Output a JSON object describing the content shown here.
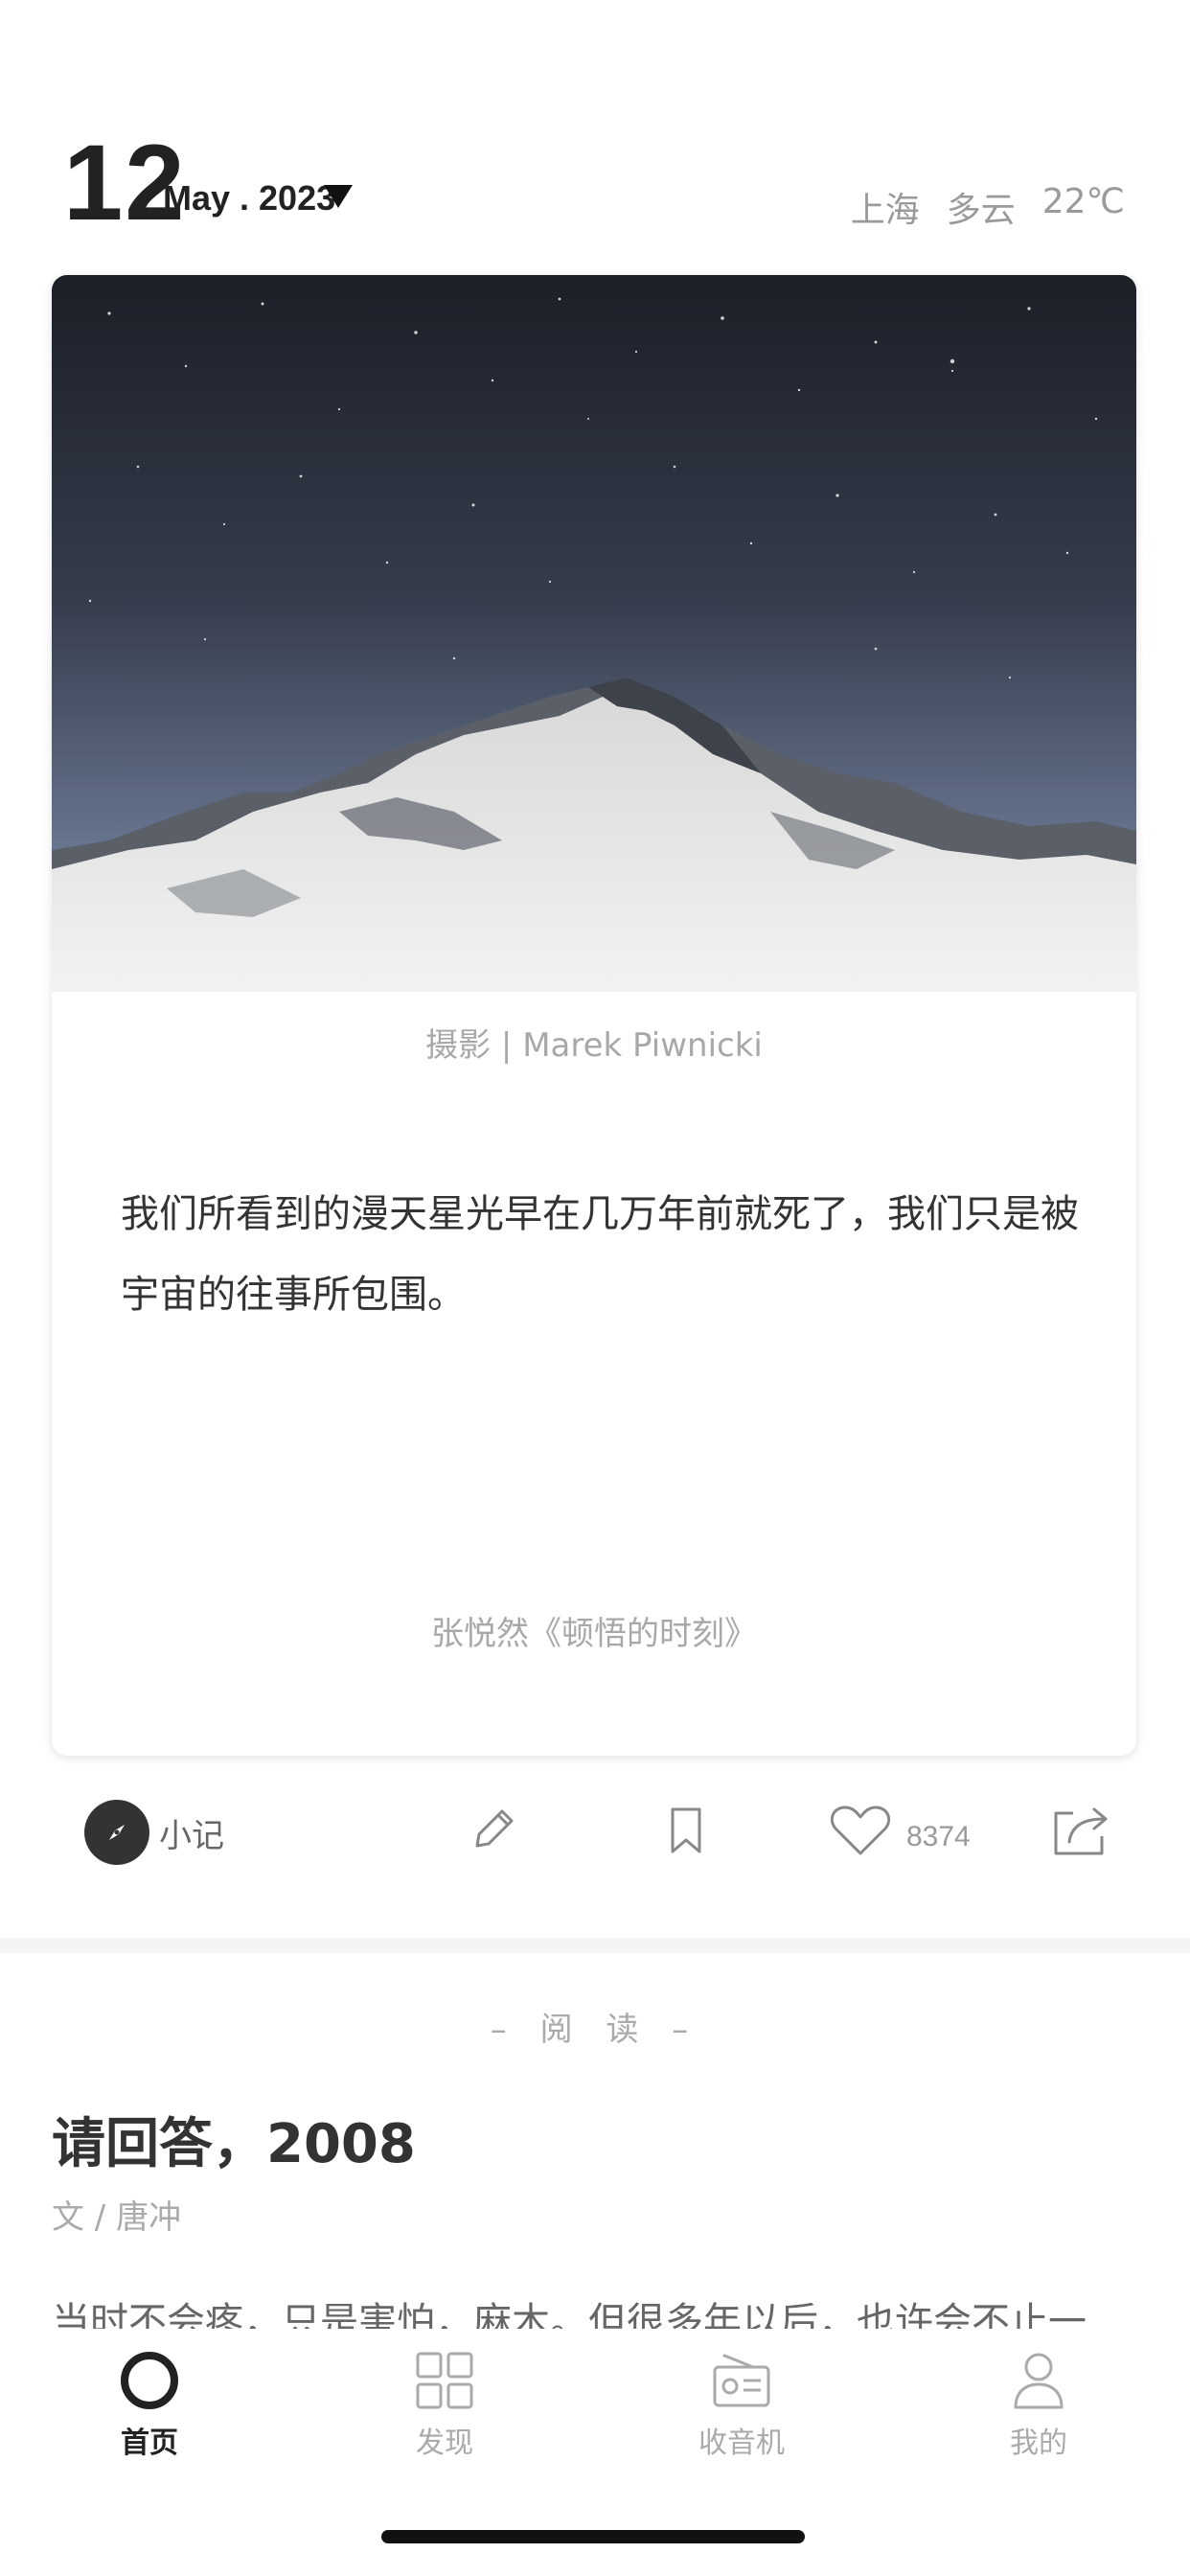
{
  "header": {
    "day": "12",
    "month_year": "May . 2023",
    "city": "上海",
    "weather": "多云",
    "temperature": "22℃"
  },
  "card": {
    "photo_credit": "摄影 | Marek Piwnicki",
    "quote": "我们所看到的漫天星光早在几万年前就死了，我们只是被宇宙的往事所包围。",
    "source": "张悦然《顿悟的时刻》"
  },
  "actions": {
    "note_label": "小记",
    "like_count": "8374"
  },
  "reading": {
    "section_heading": "– 阅 读 –",
    "title": "请回答，2008",
    "author": "文 / 唐冲",
    "excerpt": "当时不会疼，只是害怕，麻木。但很多年以后，也许会不止一"
  },
  "tabs": [
    {
      "label": "首页",
      "icon": "home-ring-icon"
    },
    {
      "label": "发现",
      "icon": "grid-icon"
    },
    {
      "label": "收音机",
      "icon": "radio-icon"
    },
    {
      "label": "我的",
      "icon": "person-icon"
    }
  ]
}
